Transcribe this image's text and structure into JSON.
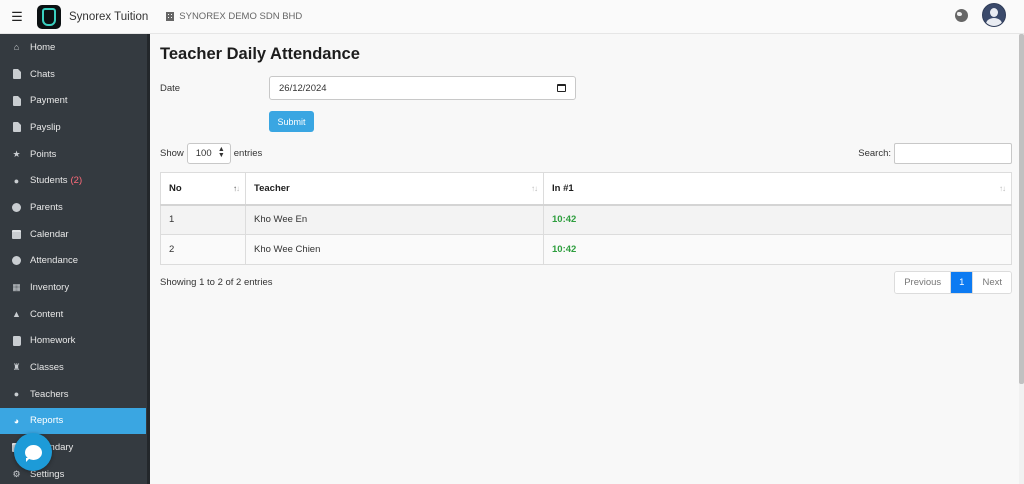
{
  "header": {
    "menu_icon": "hamburger-menu-icon",
    "app_name": "Synorex Tuition",
    "company_name": "SYNOREX DEMO SDN BHD"
  },
  "sidebar": {
    "items": [
      {
        "label": "Home",
        "icon": "home-icon"
      },
      {
        "label": "Chats",
        "icon": "document-icon"
      },
      {
        "label": "Payment",
        "icon": "document-icon"
      },
      {
        "label": "Payslip",
        "icon": "document-icon"
      },
      {
        "label": "Points",
        "icon": "star-icon"
      },
      {
        "label": "Students",
        "icon": "users-icon",
        "badge": "(2)"
      },
      {
        "label": "Parents",
        "icon": "user-circle-icon"
      },
      {
        "label": "Calendar",
        "icon": "calendar-icon"
      },
      {
        "label": "Attendance",
        "icon": "clock-icon"
      },
      {
        "label": "Inventory",
        "icon": "boxes-icon"
      },
      {
        "label": "Content",
        "icon": "megaphone-icon"
      },
      {
        "label": "Homework",
        "icon": "book-icon"
      },
      {
        "label": "Classes",
        "icon": "school-icon"
      },
      {
        "label": "Teachers",
        "icon": "teacher-icon"
      },
      {
        "label": "Reports",
        "icon": "pie-chart-icon",
        "active": true
      },
      {
        "label": "Calendary",
        "icon": "calendar-icon"
      },
      {
        "label": "Settings",
        "icon": "gears-icon"
      }
    ]
  },
  "main": {
    "title": "Teacher Daily Attendance",
    "date_label": "Date",
    "date_value": "26/12/2024",
    "submit_label": "Submit",
    "show_label": "Show",
    "entries_value": "100",
    "entries_label": "entries",
    "search_label": "Search:",
    "table": {
      "columns": [
        "No",
        "Teacher",
        "In #1"
      ],
      "rows": [
        [
          "1",
          "Kho Wee En",
          "10:42"
        ],
        [
          "2",
          "Kho Wee Chien",
          "10:42"
        ]
      ]
    },
    "info_text": "Showing 1 to 2 of 2 entries",
    "pagination": {
      "previous": "Previous",
      "current": "1",
      "next": "Next"
    }
  },
  "colors": {
    "sidebar_bg": "#343a40",
    "accent": "#3aa6e2",
    "time_green": "#2e9e3e",
    "page_active": "#0d7bf2"
  }
}
